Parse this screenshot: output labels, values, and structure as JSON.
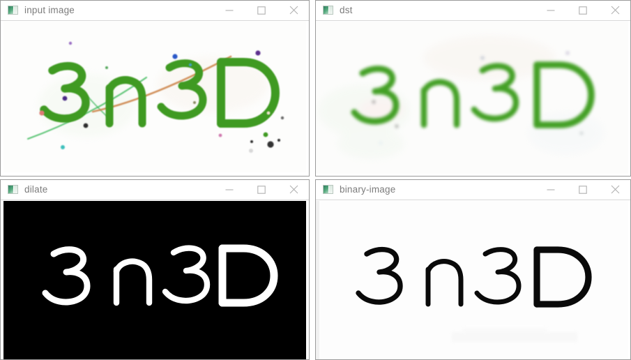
{
  "desktop": {
    "background": "#ffffff",
    "window_count": 4,
    "layout": "2x2 grid of OpenCV HighGUI image windows"
  },
  "window_controls": {
    "minimize": {
      "label": "Minimize",
      "icon": "minimize-icon",
      "glyph": "—"
    },
    "maximize": {
      "label": "Maximize",
      "icon": "maximize-icon",
      "glyph": "□"
    },
    "close": {
      "label": "Close",
      "icon": "close-icon",
      "glyph": "×"
    }
  },
  "colors": {
    "title_text": "#7c7c7c",
    "control_stroke": "#b0b0b0",
    "window_border": "#9a9a9a",
    "ink_green": "#3f9a22",
    "ink_green_dark": "#2f7a18",
    "ink_black": "#0a0a0a",
    "canvas_black": "#000000",
    "canvas_white": "#ffffff",
    "noise_orange": "#d08a52",
    "noise_purple": "#5d2f8e",
    "noise_pink": "#e0736f",
    "noise_teal": "#4bc6c0",
    "noise_blue": "#2a58c8",
    "noise_gray": "#3a3a3a"
  },
  "windows": [
    {
      "id": "input-image",
      "title": "input image",
      "icon": "opencv-window-icon",
      "position": "top-left",
      "content": {
        "kind": "color-photo",
        "text_depicted": "3n3D",
        "description": "Green handwritten characters on white paper with colored salt-and-pepper noise, a thin green diagonal stroke and an orange-brown curved stroke crossing the text",
        "ink_color": "#3f9a22",
        "background": "#fdfdfc",
        "has_noise": "yes",
        "noise_kinds": "colored speckles, green diagonal line, orange curve"
      }
    },
    {
      "id": "dst",
      "title": "dst",
      "icon": "opencv-window-icon",
      "position": "top-right",
      "content": {
        "kind": "color-photo",
        "text_depicted": "3n3D",
        "description": "Denoised / smoothed version of the input: the same green characters on white with the speckles and crossing strokes removed, edges softened by blur",
        "ink_color": "#47a22a",
        "background": "#fcfcfb",
        "has_noise": "no",
        "noise_kinds": "faint residual color haze"
      }
    },
    {
      "id": "dilate",
      "title": "dilate",
      "icon": "opencv-window-icon",
      "position": "bottom-left",
      "content": {
        "kind": "binary-mask",
        "text_depicted": "3n3D",
        "description": "Inverted binary mask after dilation: thick white characters on a solid black background",
        "ink_color": "#ffffff",
        "background": "#000000",
        "has_noise": "no",
        "noise_kinds": "none"
      }
    },
    {
      "id": "binary-image",
      "title": "binary-image",
      "icon": "opencv-window-icon",
      "position": "bottom-right",
      "content": {
        "kind": "binary-mask",
        "text_depicted": "3n3D",
        "description": "Thresholded binary image: solid black characters on a white background with a faint light-gray artifact band at the lower right",
        "ink_color": "#0a0a0a",
        "background": "#fdfdfd",
        "has_noise": "no",
        "noise_kinds": "faint gray band lower-right"
      }
    }
  ]
}
